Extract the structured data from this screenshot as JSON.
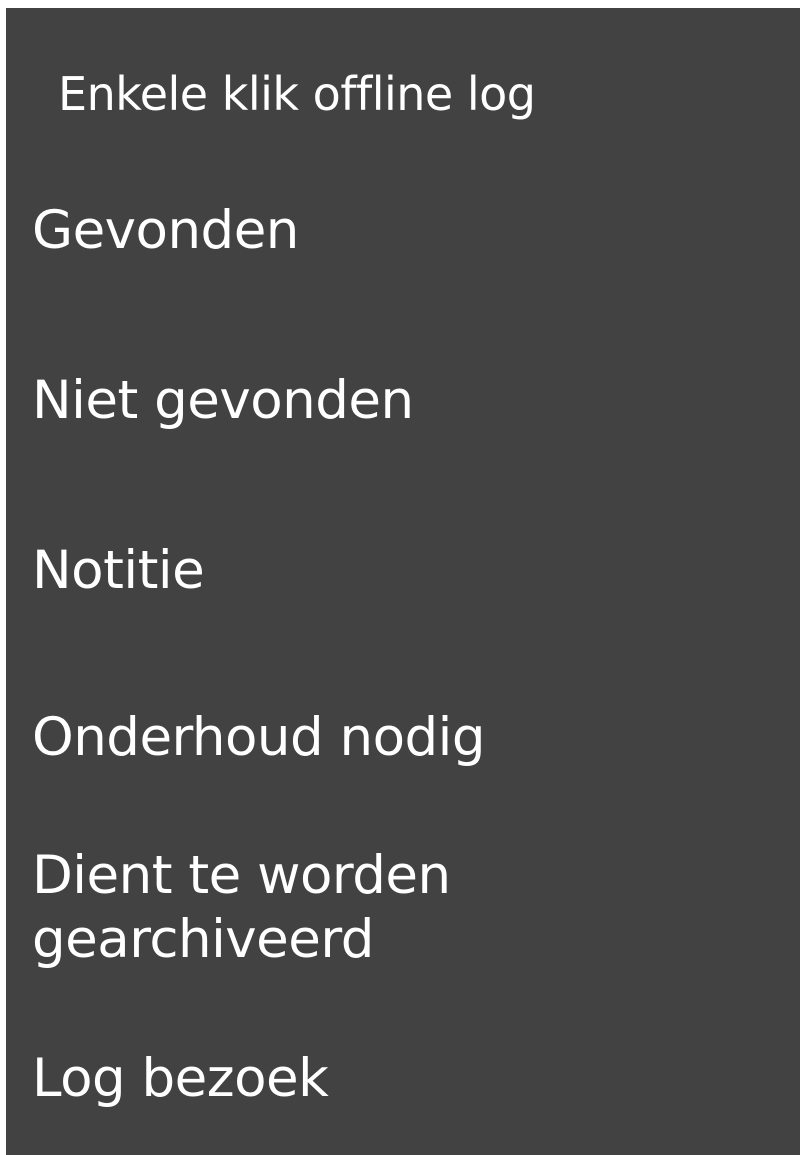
{
  "dialog": {
    "title": "Enkele klik offline log",
    "items": [
      {
        "label": "Gevonden"
      },
      {
        "label": "Niet gevonden"
      },
      {
        "label": "Notitie"
      },
      {
        "label": "Onderhoud nodig"
      },
      {
        "label": "Dient te worden gearchiveerd"
      },
      {
        "label": "Log bezoek"
      }
    ],
    "background_color": "#424242",
    "text_color": "#ffffff"
  }
}
